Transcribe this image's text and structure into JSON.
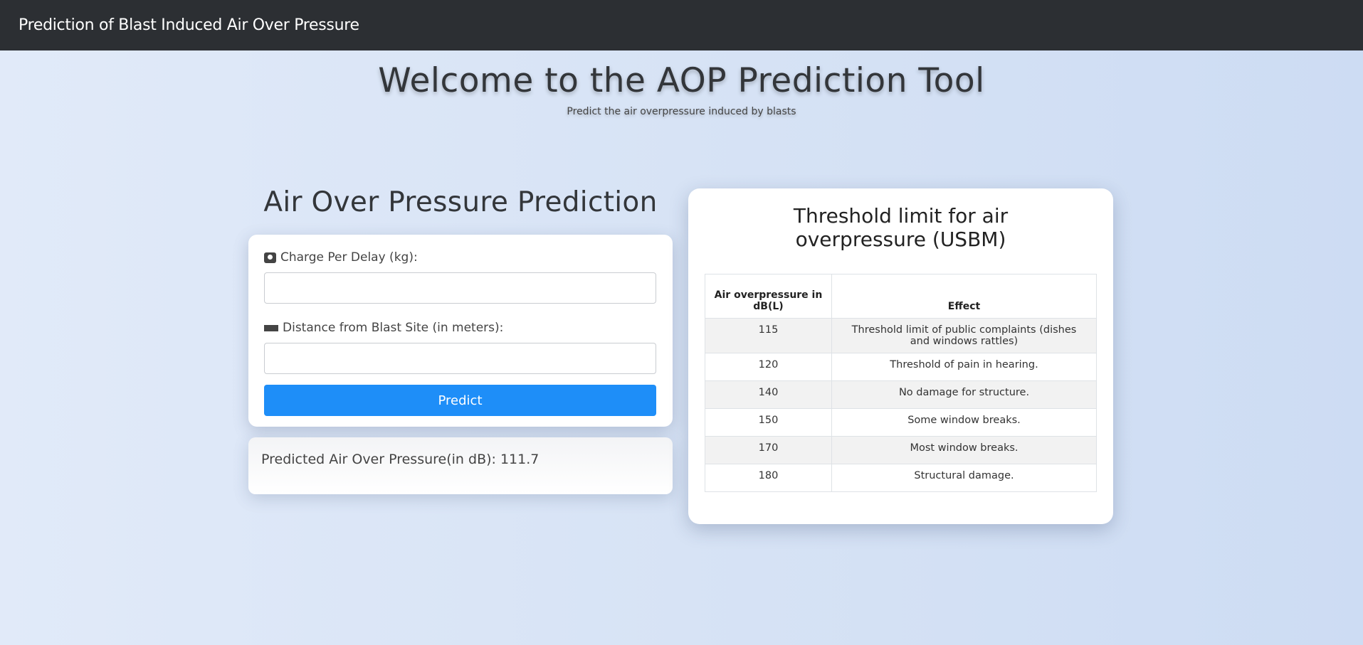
{
  "navbar": {
    "brand": "Prediction of Blast Induced Air Over Pressure"
  },
  "hero": {
    "title": "Welcome to the AOP Prediction Tool",
    "subtitle": "Predict the air overpressure induced by blasts"
  },
  "form": {
    "title": "Air Over Pressure Prediction",
    "charge_label": "Charge Per Delay (kg):",
    "charge_value": "",
    "distance_label": "Distance from Blast Site (in meters):",
    "distance_value": "",
    "button_label": "Predict",
    "charge_icon": "weight-scale-icon",
    "distance_icon": "ruler-icon"
  },
  "result": {
    "text": "Predicted Air Over Pressure(in dB): 111.7"
  },
  "threshold": {
    "title": "Threshold limit for air overpressure (USBM)",
    "columns": [
      "Air overpressure in dB(L)",
      "Effect"
    ],
    "rows": [
      {
        "db": "115",
        "effect": "Threshold limit of public complaints (dishes and windows rattles)"
      },
      {
        "db": "120",
        "effect": "Threshold of pain in hearing."
      },
      {
        "db": "140",
        "effect": "No damage for structure."
      },
      {
        "db": "150",
        "effect": "Some window breaks."
      },
      {
        "db": "170",
        "effect": "Most window breaks."
      },
      {
        "db": "180",
        "effect": "Structural damage."
      }
    ]
  },
  "colors": {
    "navbar_bg": "#2c2f33",
    "button_bg": "#1e8ef8",
    "page_bg_start": "#e1eaf9",
    "page_bg_end": "#cddcf3"
  }
}
